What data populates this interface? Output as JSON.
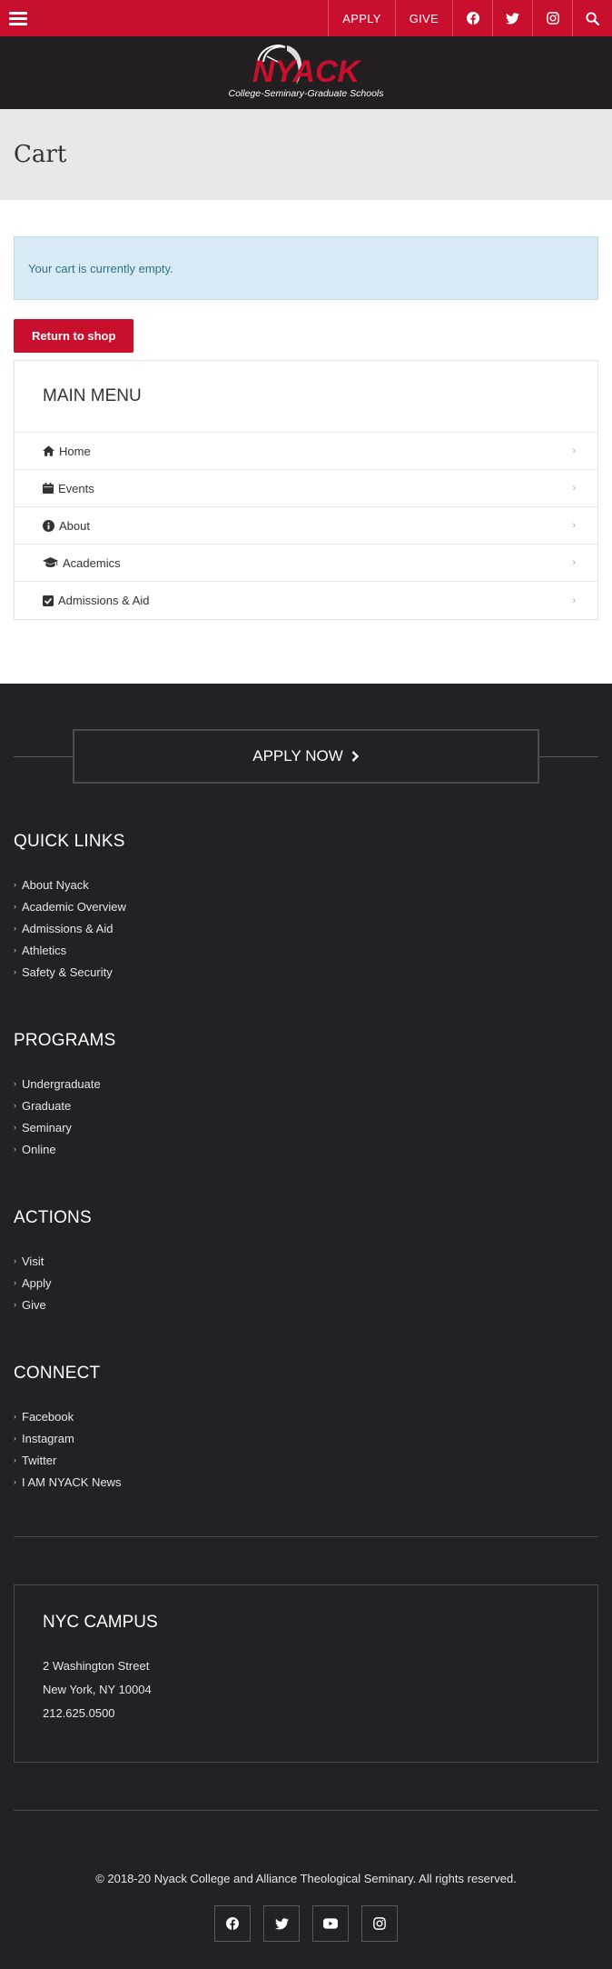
{
  "topbar": {
    "apply_label": "APPLY",
    "give_label": "GIVE",
    "icons": [
      "menu-icon",
      "facebook-icon",
      "twitter-icon",
      "instagram-icon",
      "search-icon"
    ]
  },
  "logo": {
    "name": "NYACK",
    "tagline": "College-Seminary-Graduate Schools"
  },
  "page": {
    "title": "Cart"
  },
  "cart": {
    "empty_message": "Your cart is currently empty.",
    "return_label": "Return to shop"
  },
  "main_menu": {
    "title": "MAIN MENU",
    "items": [
      {
        "label": "Home",
        "icon": "home-icon"
      },
      {
        "label": "Events",
        "icon": "calendar-icon"
      },
      {
        "label": "About",
        "icon": "info-icon"
      },
      {
        "label": "Academics",
        "icon": "graduation-cap-icon"
      },
      {
        "label": "Admissions & Aid",
        "icon": "check-square-icon"
      }
    ]
  },
  "footer": {
    "apply_now": "APPLY NOW",
    "sections": [
      {
        "title": "QUICK LINKS",
        "links": [
          "About Nyack",
          "Academic Overview",
          "Admissions & Aid",
          "Athletics",
          "Safety & Security"
        ]
      },
      {
        "title": "PROGRAMS",
        "links": [
          "Undergraduate",
          "Graduate",
          "Seminary",
          "Online"
        ]
      },
      {
        "title": "ACTIONS",
        "links": [
          "Visit",
          "Apply",
          "Give"
        ]
      },
      {
        "title": "CONNECT",
        "links": [
          "Facebook",
          "Instagram",
          "Twitter",
          "I AM NYACK News"
        ]
      }
    ],
    "campus": {
      "title": "NYC CAMPUS",
      "street": "2 Washington Street",
      "city": "New York, NY 10004",
      "phone": "212.625.0500"
    },
    "copyright": "© 2018-20 Nyack College and Alliance Theological Seminary. All rights reserved.",
    "socials": [
      "facebook-icon",
      "twitter-icon",
      "youtube-icon",
      "instagram-icon"
    ]
  },
  "colors": {
    "brand": "#c8102e",
    "dark": "#231f20",
    "footer_bg": "#222226",
    "notice_bg": "#d8ebf5"
  }
}
